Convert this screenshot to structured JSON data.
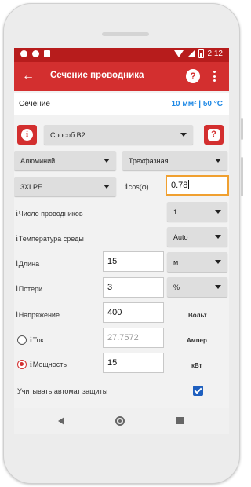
{
  "status_bar": {
    "time": "2:12"
  },
  "app_bar": {
    "back_icon": "arrow-left-icon",
    "title": "Сечение проводника",
    "help_label": "?"
  },
  "section": {
    "label": "Сечение",
    "value": "10 мм² | 50 °C"
  },
  "method": {
    "selected": "Способ В2",
    "info_label": "i",
    "help_label": "?"
  },
  "material": {
    "selected": "Алюминий"
  },
  "phase": {
    "selected": "Трехфазная"
  },
  "insulation": {
    "selected": "3XLPE"
  },
  "cos": {
    "info": "i",
    "label": "cos(φ)",
    "value": "0.78"
  },
  "conductors": {
    "info": "i",
    "label": "Число проводников",
    "selected": "1"
  },
  "temperature": {
    "info": "i",
    "label": "Температура среды",
    "selected": "Auto"
  },
  "length": {
    "info": "i",
    "label": "Длина",
    "value": "15",
    "unit": "м"
  },
  "losses": {
    "info": "i",
    "label": "Потери",
    "value": "3",
    "unit": "%"
  },
  "voltage": {
    "info": "i",
    "label": "Напряжение",
    "value": "400",
    "unit": "Вольт"
  },
  "current": {
    "info": "i",
    "label": "Ток",
    "value": "27.7572",
    "unit": "Ампер",
    "selected": false
  },
  "power": {
    "info": "i",
    "label": "Мощность",
    "value": "15",
    "unit": "кВт",
    "selected": true
  },
  "breaker": {
    "label": "Учитывать автомат защиты",
    "checked": true
  },
  "colors": {
    "primary": "#d32f2f",
    "status": "#b71c1c",
    "accent": "#1e88e5",
    "focus": "#f0a030"
  }
}
